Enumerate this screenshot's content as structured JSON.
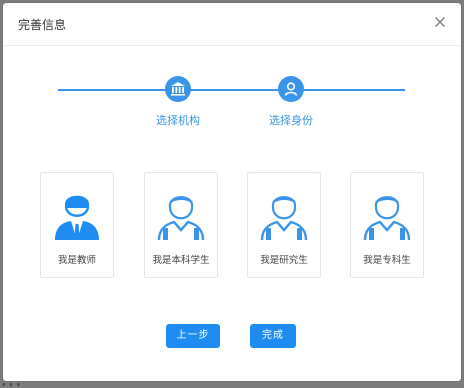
{
  "background": {
    "text": "…"
  },
  "dialog": {
    "title": "完善信息",
    "close_icon": "close-icon"
  },
  "steps": [
    {
      "label": "选择机构",
      "icon": "bank-icon"
    },
    {
      "label": "选择身份",
      "icon": "user-icon"
    }
  ],
  "roles": [
    {
      "label": "我是教师",
      "icon": "teacher-icon"
    },
    {
      "label": "我是本科学生",
      "icon": "undergraduate-icon"
    },
    {
      "label": "我是研究生",
      "icon": "graduate-icon"
    },
    {
      "label": "我是专科生",
      "icon": "junior-college-icon"
    }
  ],
  "buttons": {
    "prev_label": "上一步",
    "finish_label": "完成"
  },
  "colors": {
    "accent": "#3a95e8",
    "button": "#1e8cf0"
  }
}
